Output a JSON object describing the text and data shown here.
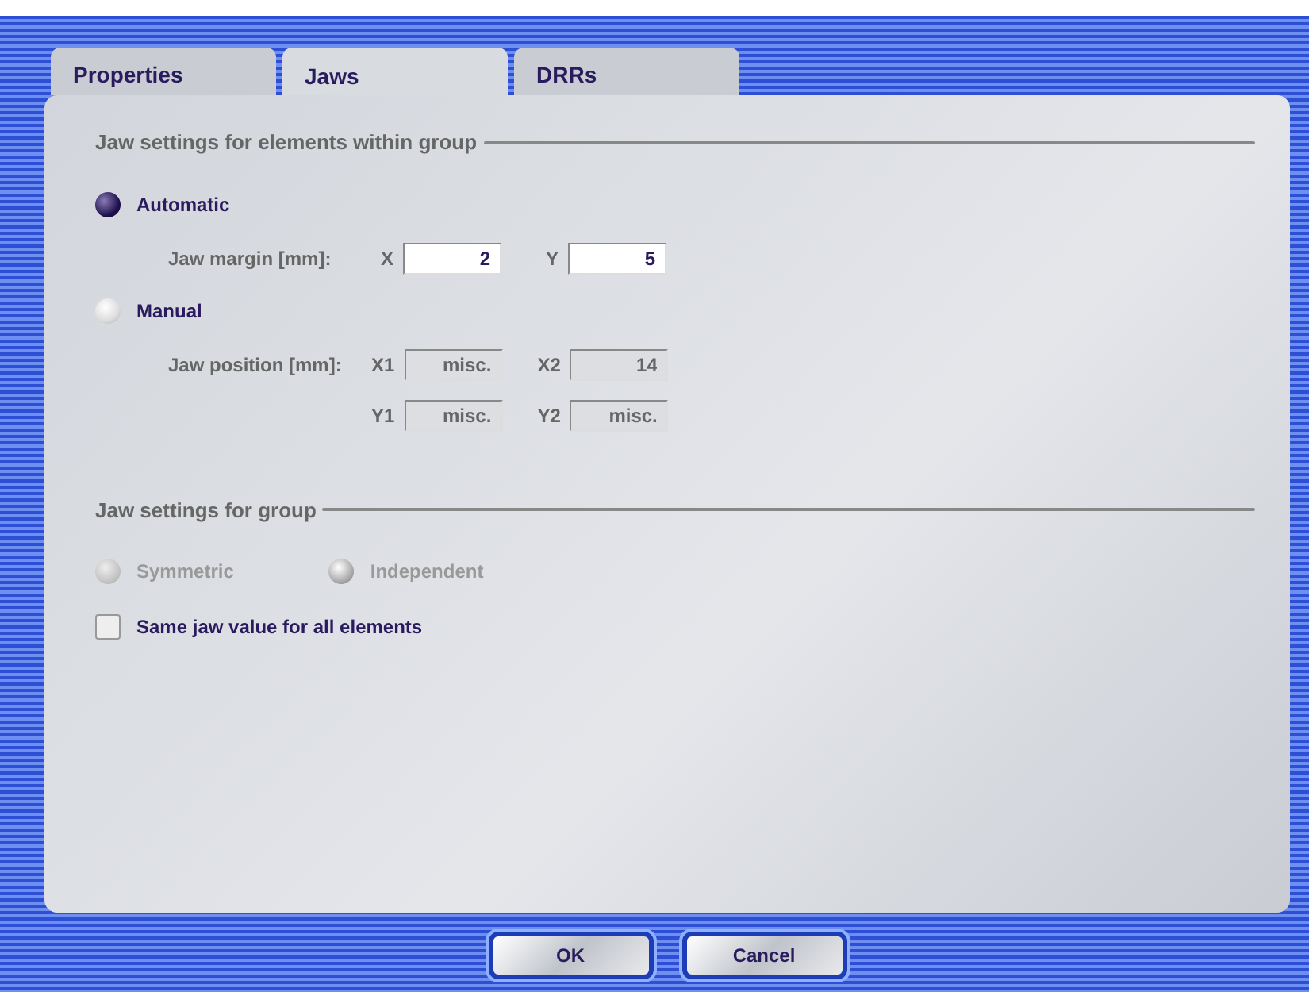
{
  "tabs": [
    {
      "label": "Properties",
      "selected": false
    },
    {
      "label": "Jaws",
      "selected": true
    },
    {
      "label": "DRRs",
      "selected": false
    }
  ],
  "sections": [
    {
      "title": "Jaw settings for elements within group",
      "rows": [
        {
          "kind": "radio",
          "label": "Automatic",
          "selected": true,
          "disabled": false
        },
        {
          "kind": "fields",
          "label": "Jaw margin [mm]:",
          "fields": [
            {
              "label": "X",
              "value": "2",
              "disabled": false
            },
            {
              "label": "Y",
              "value": "5",
              "disabled": false
            }
          ]
        },
        {
          "kind": "radio",
          "label": "Manual",
          "selected": false,
          "disabled": false
        },
        {
          "kind": "fields",
          "label": "Jaw position [mm]:",
          "fields": [
            {
              "label": "X1",
              "value": "misc.",
              "disabled": true
            },
            {
              "label": "X2",
              "value": "14",
              "disabled": true
            }
          ]
        },
        {
          "kind": "fields",
          "fields": [
            {
              "label": "Y1",
              "value": "misc.",
              "disabled": true
            },
            {
              "label": "Y2",
              "value": "misc.",
              "disabled": true
            }
          ]
        }
      ]
    },
    {
      "title": "Jaw settings for group",
      "rows": [
        {
          "kind": "radiogroup",
          "options": [
            {
              "label": "Symmetric",
              "selected": false,
              "disabled": true
            },
            {
              "label": "Independent",
              "selected": true,
              "disabled": true
            }
          ]
        },
        {
          "kind": "checkbox",
          "label": "Same jaw value for all elements",
          "checked": false
        }
      ]
    }
  ],
  "buttons": [
    "OK",
    "Cancel"
  ]
}
